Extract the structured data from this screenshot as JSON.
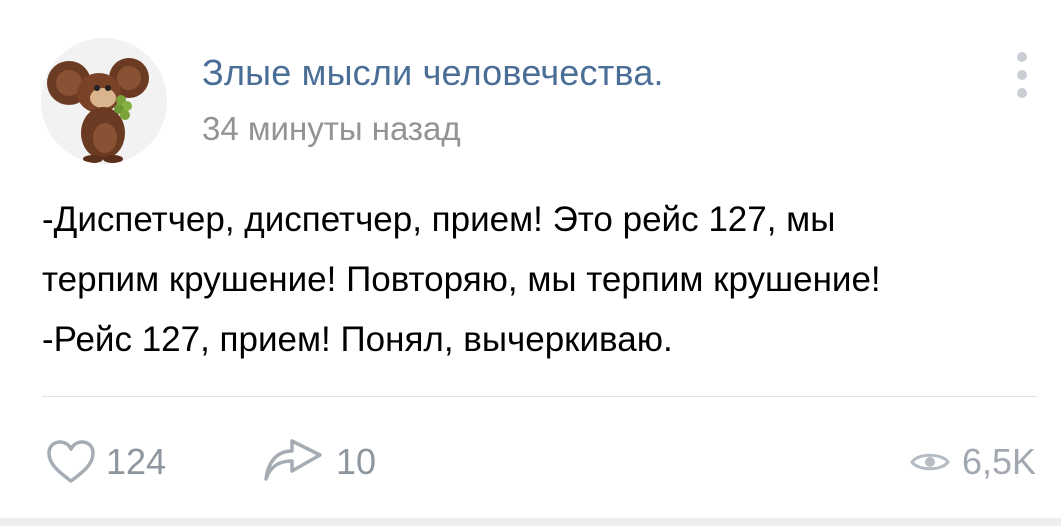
{
  "post": {
    "author_name": "Злые мысли человечества.",
    "timestamp": "34 минуты назад",
    "text_lines": [
      "-Диспетчер, диспетчер, прием! Это рейс 127, мы",
      "терпим крушение! Повторяю, мы терпим крушение!",
      "-Рейс 127, прием! Понял, вычеркиваю."
    ]
  },
  "actions": {
    "likes": "124",
    "shares": "10",
    "views": "6,5K"
  },
  "icons": {
    "avatar": "cheburashka-avatar",
    "menu": "more-vertical-icon",
    "like": "heart-icon",
    "share": "share-arrow-icon",
    "views": "eye-icon"
  },
  "colors": {
    "author": "#4a6e96",
    "timestamp": "#939393",
    "icon": "#a5acb4"
  }
}
